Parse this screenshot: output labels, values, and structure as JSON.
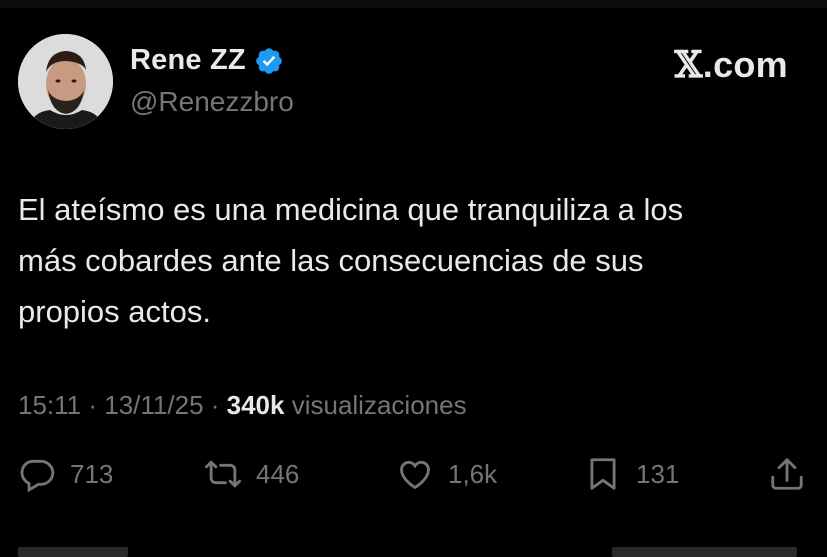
{
  "user": {
    "name": "Rene ZZ",
    "handle": "@Renezzbro",
    "verified": true
  },
  "brand": {
    "x": "𝕏",
    "dotcom": ".com"
  },
  "tweet": {
    "line1": "El ateísmo es una medicina que tranquiliza a los",
    "line2": "más cobardes ante las consecuencias de sus",
    "line3": "propios actos."
  },
  "meta": {
    "time": "15:11",
    "sep1": " · ",
    "date": "13/11/25",
    "sep2": " · ",
    "views": "340k",
    "views_label": " visualizaciones"
  },
  "actions": {
    "replies": "713",
    "reposts": "446",
    "likes": "1,6k",
    "bookmarks": "131"
  },
  "icons": [
    "reply-icon",
    "repost-icon",
    "like-icon",
    "bookmark-icon",
    "share-icon",
    "verified-badge-icon"
  ],
  "colors": {
    "background": "#000000",
    "text": "#e7e9ea",
    "secondary": "#71767b",
    "verified": "#1d9bf0"
  }
}
